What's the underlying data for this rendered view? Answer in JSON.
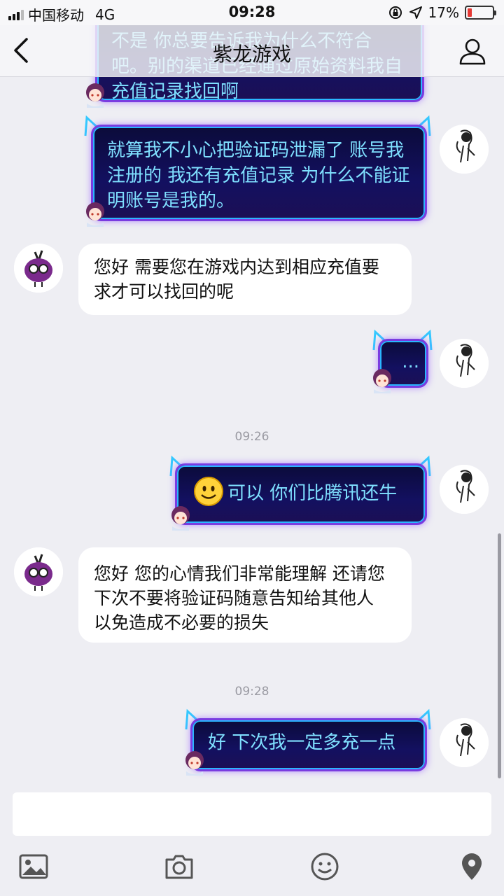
{
  "status_bar": {
    "carrier": "中国移动",
    "network": "4G",
    "time": "09:28",
    "battery_percent": "17%",
    "battery_level": 0.17
  },
  "header": {
    "title": "紫龙游戏",
    "back_icon": "chevron-left-icon",
    "profile_icon": "person-icon"
  },
  "messages": [
    {
      "side": "right",
      "style": "dark",
      "text": "不是 你总要告诉我为什么不符合吧。别的渠道已经通过原始资料我自充值记录找回啊"
    },
    {
      "side": "right",
      "style": "dark",
      "text": "就算我不小心把验证码泄漏了 账号我注册的 我还有充值记录 为什么不能证明账号是我的。"
    },
    {
      "side": "left",
      "style": "white",
      "text": "您好 需要您在游戏内达到相应充值要求才可以找回的呢"
    },
    {
      "side": "right",
      "style": "dark",
      "text": "..."
    },
    {
      "side": "right",
      "style": "dark",
      "emoji": "smile-emoji",
      "text": "可以 你们比腾讯还牛"
    },
    {
      "side": "left",
      "style": "white",
      "text": "您好  您的心情我们非常能理解 还请您下次不要将验证码随意告知给其他人 以免造成不必要的损失"
    },
    {
      "side": "right",
      "style": "dark",
      "text": "好 下次我一定多充一点"
    }
  ],
  "timestamps": [
    "09:26",
    "09:28"
  ],
  "input": {
    "value": "",
    "placeholder": ""
  },
  "toolbar": {
    "icons": [
      "image-icon",
      "camera-icon",
      "emoji-icon",
      "location-icon"
    ]
  },
  "colors": {
    "bubble_text": "#7fe0ff",
    "bubble_border": "#7a3ce0",
    "background": "#eeeef3"
  }
}
